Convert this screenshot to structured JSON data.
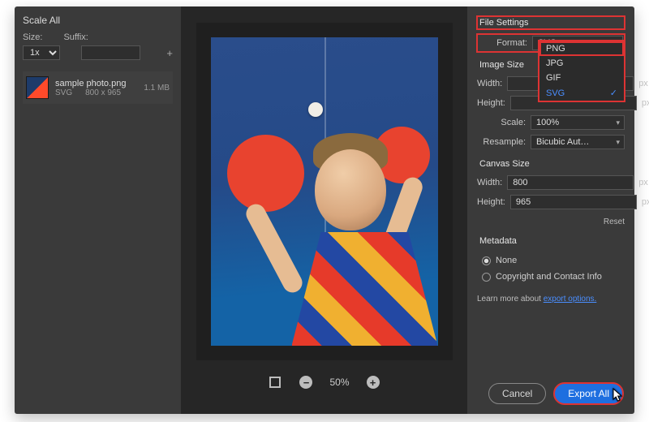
{
  "left": {
    "title": "Scale All",
    "size_label": "Size:",
    "suffix_label": "Suffix:",
    "scale_value": "1x",
    "plus": "+",
    "file": {
      "name": "sample photo.png",
      "format": "SVG",
      "dimensions": "800 x 965",
      "size": "1.1 MB"
    }
  },
  "zoom": {
    "value": "50%"
  },
  "right": {
    "file_settings_title": "File Settings",
    "format_label": "Format:",
    "format_value": "SVG",
    "format_options": {
      "png": "PNG",
      "jpg": "JPG",
      "gif": "GIF",
      "svg": "SVG"
    },
    "image_size_title": "Image Size",
    "width_label": "Width:",
    "height_label": "Height:",
    "width_value": "",
    "height_value": "",
    "px": "px",
    "scale_label": "Scale:",
    "scale_value": "100%",
    "resample_label": "Resample:",
    "resample_value": "Bicubic Aut…",
    "canvas_size_title": "Canvas Size",
    "canvas_width": "800",
    "canvas_height": "965",
    "reset": "Reset",
    "metadata_title": "Metadata",
    "metadata_none": "None",
    "metadata_copyright": "Copyright and Contact Info",
    "learn_prefix": "Learn more about ",
    "learn_link": "export options."
  },
  "footer": {
    "cancel": "Cancel",
    "export": "Export All"
  }
}
